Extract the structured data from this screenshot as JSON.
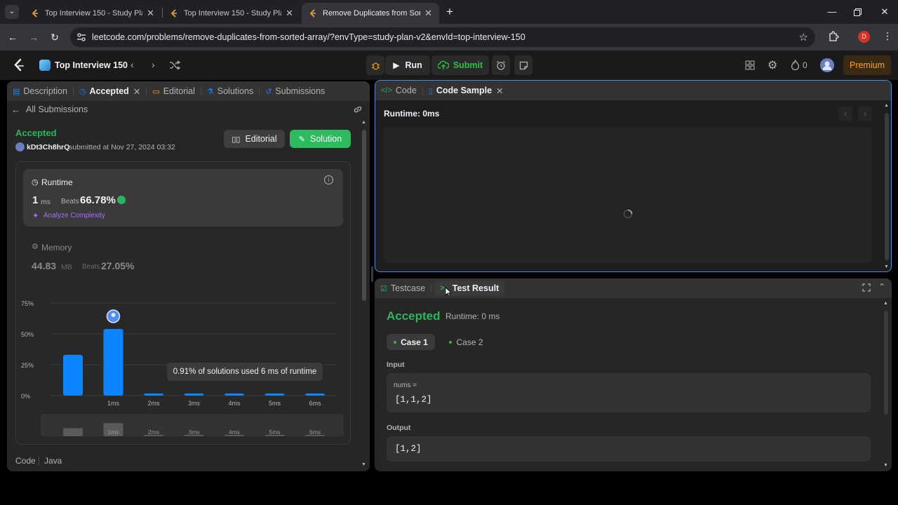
{
  "browser": {
    "tabs": [
      {
        "title": "Top Interview 150 - Study Plan",
        "active": false
      },
      {
        "title": "Top Interview 150 - Study Plan",
        "active": false
      },
      {
        "title": "Remove Duplicates from Sorted Array",
        "active": true
      }
    ],
    "url": "leetcode.com/problems/remove-duplicates-from-sorted-array/?envType=study-plan-v2&envId=top-interview-150",
    "profile_initial": "D"
  },
  "header": {
    "study_plan": "Top Interview 150",
    "run_label": "Run",
    "submit_label": "Submit",
    "streak_count": "0",
    "premium_label": "Premium"
  },
  "left_tabs": [
    {
      "label": "Description",
      "icon": "document-icon",
      "active": false
    },
    {
      "label": "Accepted",
      "icon": "clock-icon",
      "active": true
    },
    {
      "label": "Editorial",
      "icon": "book-icon",
      "active": false
    },
    {
      "label": "Solutions",
      "icon": "flask-icon",
      "active": false
    },
    {
      "label": "Submissions",
      "icon": "history-icon",
      "active": false
    }
  ],
  "submission": {
    "back_label": "All Submissions",
    "status": "Accepted",
    "username": "kDt3Ch8hrQ",
    "submitted_text": "submitted at Nov 27, 2024 03:32",
    "editorial_button": "Editorial",
    "solution_button": "Solution",
    "runtime": {
      "label": "Runtime",
      "value": "1",
      "unit": "ms",
      "beats_label": "Beats",
      "beats_value": "66.78%",
      "analyze_label": "Analyze Complexity"
    },
    "memory": {
      "label": "Memory",
      "value": "44.83",
      "unit": "MB",
      "beats_label": "Beats",
      "beats_value": "27.05%"
    },
    "tooltip": "0.91% of solutions used 6 ms of runtime",
    "code_label": "Code",
    "language": "Java"
  },
  "chart_data": {
    "type": "bar",
    "categories": [
      "",
      "1ms",
      "2ms",
      "3ms",
      "4ms",
      "5ms",
      "6ms"
    ],
    "values": [
      33,
      54,
      1,
      1,
      1,
      1,
      1
    ],
    "y_ticks": [
      "75%",
      "50%",
      "25%",
      "0%"
    ],
    "ylim": [
      0,
      75
    ],
    "highlight_index": 1,
    "colors": {
      "bar": "#0a84ff",
      "grid": "#3a3a3a"
    },
    "minimap_labels": [
      "",
      "1ms",
      "2ms",
      "3ms",
      "4ms",
      "5ms",
      "6ms"
    ]
  },
  "code_panel": {
    "tabs": [
      {
        "label": "Code",
        "icon": "code-icon",
        "active": false
      },
      {
        "label": "Code Sample",
        "icon": "file-icon",
        "active": true
      }
    ],
    "runtime_label": "Runtime: 0ms"
  },
  "test_panel": {
    "tabs": [
      {
        "label": "Testcase",
        "icon": "checkbox-icon",
        "active": false
      },
      {
        "label": "Test Result",
        "icon": "terminal-icon",
        "active": true
      }
    ],
    "status": "Accepted",
    "runtime_text": "Runtime: 0 ms",
    "cases": [
      {
        "label": "Case 1",
        "active": true
      },
      {
        "label": "Case 2",
        "active": false
      }
    ],
    "input_label": "Input",
    "input_var": "nums =",
    "input_value": "[1,1,2]",
    "output_label": "Output",
    "output_value": "[1,2]"
  },
  "colors": {
    "accepted_green": "#2db55d",
    "submit_green": "#28c244",
    "premium_orange": "#ffa116",
    "link_blue": "#0a84ff",
    "analyze_purple": "#a770ef"
  }
}
